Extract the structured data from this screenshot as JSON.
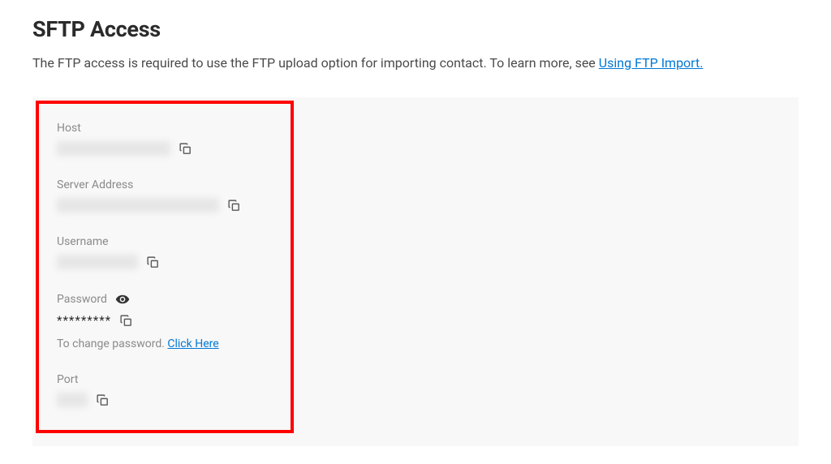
{
  "header": {
    "title": "SFTP Access",
    "subtitle_prefix": "The FTP access is required to use the FTP upload option for importing contact. To learn more, see ",
    "subtitle_link": "Using FTP Import."
  },
  "fields": {
    "host": {
      "label": "Host",
      "value": "ftp.██████.com"
    },
    "server_address": {
      "label": "Server Address",
      "value": "sftp://ftp.██████.com"
    },
    "username": {
      "label": "Username",
      "value": "██████_FTP"
    },
    "password": {
      "label": "Password",
      "value": "*********",
      "helper_prefix": "To change password. ",
      "helper_link": "Click Here"
    },
    "port": {
      "label": "Port",
      "value": "████"
    }
  }
}
